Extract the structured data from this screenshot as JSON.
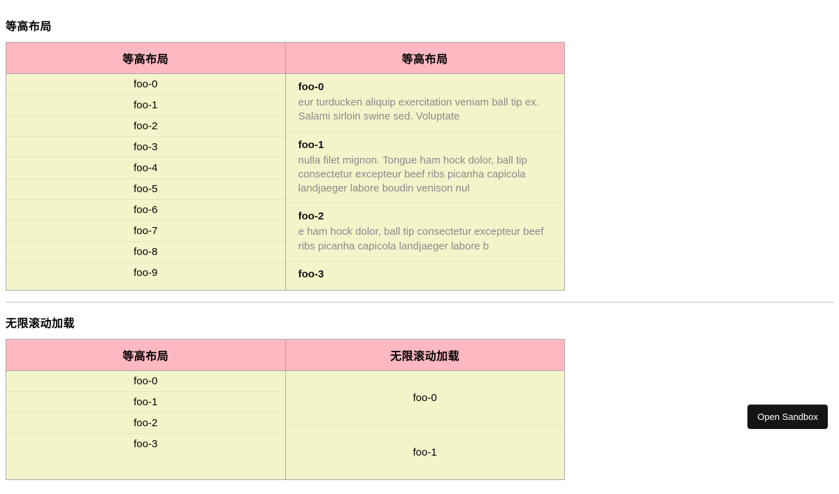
{
  "section1": {
    "heading": "等高布局",
    "headers": {
      "left": "等高布局",
      "right": "等高布局"
    },
    "left_items": [
      {
        "label": "foo-0"
      },
      {
        "label": "foo-1"
      },
      {
        "label": "foo-2"
      },
      {
        "label": "foo-3"
      },
      {
        "label": "foo-4"
      },
      {
        "label": "foo-5"
      },
      {
        "label": "foo-6"
      },
      {
        "label": "foo-7"
      },
      {
        "label": "foo-8"
      },
      {
        "label": "foo-9"
      }
    ],
    "right_items": [
      {
        "title": "foo-0",
        "desc": "eur turducken aliquip exercitation veniam ball tip ex. Salami sirloin swine sed. Voluptate"
      },
      {
        "title": "foo-1",
        "desc": "nulla filet mignon. Tongue ham hock dolor, ball tip consectetur excepteur beef ribs picanha capicola landjaeger labore boudin venison nul"
      },
      {
        "title": "foo-2",
        "desc": "e ham hock dolor, ball tip consectetur excepteur beef ribs picanha capicola landjaeger labore b"
      },
      {
        "title": "foo-3",
        "desc": ""
      }
    ]
  },
  "section2": {
    "heading": "无限滚动加载",
    "headers": {
      "left": "等高布局",
      "right": "无限滚动加载"
    },
    "left_items": [
      {
        "label": "foo-0"
      },
      {
        "label": "foo-1"
      },
      {
        "label": "foo-2"
      },
      {
        "label": "foo-3"
      }
    ],
    "right_items": [
      {
        "label": "foo-0"
      },
      {
        "label": "foo-1"
      }
    ]
  },
  "sandbox_button": "Open Sandbox"
}
